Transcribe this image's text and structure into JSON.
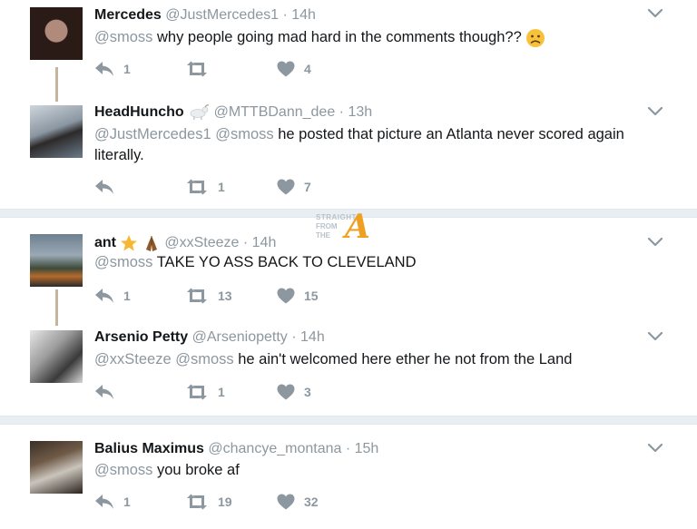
{
  "tweets": [
    {
      "name": "Mercedes",
      "handle": "@JustMercedes1",
      "time": "14h",
      "mentions": "@smoss",
      "text": " why people going mad hard in the comments though??",
      "reply": "1",
      "retweet": "",
      "like": "4"
    },
    {
      "name": "HeadHuncho",
      "handle": "@MTTBDann_dee",
      "time": "13h",
      "mentions": "@JustMercedes1 @smoss",
      "text": " he posted that picture an Atlanta never scored again literally.",
      "reply": "",
      "retweet": "1",
      "like": "7"
    },
    {
      "name": "ant",
      "handle": "@xxSteeze",
      "time": "14h",
      "mentions": "@smoss",
      "text": " TAKE YO ASS BACK TO CLEVELAND",
      "reply": "1",
      "retweet": "13",
      "like": "15"
    },
    {
      "name": "Arsenio Petty",
      "handle": "@Arseniopetty",
      "time": "14h",
      "mentions": "@xxSteeze @smoss",
      "text": " he ain't welcomed here ether he not from the Land",
      "reply": "",
      "retweet": "1",
      "like": "3"
    },
    {
      "name": "Balius Maximus",
      "handle": "@chancye_montana",
      "time": "15h",
      "mentions": "@smoss",
      "text": " you broke af",
      "reply": "1",
      "retweet": "19",
      "like": "32"
    }
  ],
  "separator": "·",
  "watermark": {
    "line1": "STRAIGHT",
    "line2": "FROM",
    "line3": "THE",
    "letter": "A"
  },
  "icons": [
    "reply-icon",
    "retweet-icon",
    "heart-icon",
    "chevron-down-icon",
    "goat-emoji",
    "star-emoji",
    "praying-hands-emoji",
    "sad-face-emoji"
  ],
  "colors": {
    "muted": "#8c979f",
    "text": "#14171a",
    "divider": "#e9eef2",
    "thread": "#c5b59e",
    "emoji_yellow": "#f7c23a",
    "watermark_orange": "#f0a020"
  }
}
